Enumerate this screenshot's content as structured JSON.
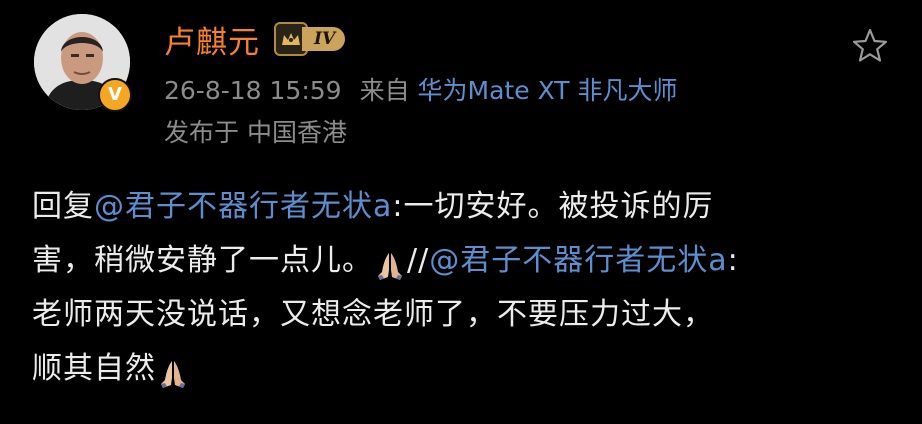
{
  "user": {
    "name": "卢麒元",
    "level": "IV",
    "verified_mark": "V"
  },
  "meta": {
    "timestamp": "26-8-18 15:59",
    "source_prefix": "来自",
    "device": "华为Mate XT 非凡大师",
    "location": "发布于 中国香港"
  },
  "post": {
    "line1_reply": "回复",
    "mention1": "@君子不器行者无状a",
    "line1_text": ":一切安好。被投诉的厉",
    "line2_text": "害，稍微安静了一点儿。",
    "forward_sep": "//",
    "mention2": "@君子不器行者无状a",
    "colon": ":",
    "line3_text": "老师两天没说话，又想念老师了，不要压力过大，",
    "line4_text": "顺其自然"
  },
  "icons": {
    "favorite": "star-outline-icon",
    "level": "crown-icon",
    "emoji": "folded-hands-emoji"
  },
  "colors": {
    "username": "#f7812c",
    "link": "#5b8fd0",
    "meta": "#8c8c8c",
    "text": "#ececec",
    "background": "#000000",
    "level_badge": "#c9a45a"
  }
}
